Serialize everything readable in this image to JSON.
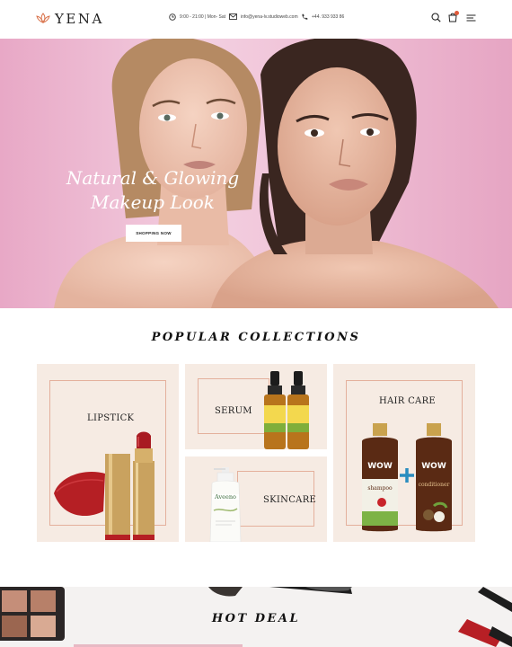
{
  "brand": {
    "name": "YENA",
    "icon": "lotus-icon"
  },
  "header": {
    "hours": "9:00 - 21:00 | Mon- Sat",
    "email": "info@yena-lv.studioweb.com",
    "phone": "+44. 933 933 86",
    "icons": [
      "clock-icon",
      "mail-icon",
      "phone-icon",
      "search-icon",
      "cart-icon",
      "menu-icon"
    ],
    "accent": "#e05a3a"
  },
  "hero": {
    "title_line1": "Natural & Glowing",
    "title_line2": "Makeup Look",
    "button": "SHOPPING NOW",
    "background": "#efbfd6"
  },
  "collections": {
    "title": "POPULAR COLLECTIONS",
    "items": [
      {
        "label": "LIPSTICK"
      },
      {
        "label": "SERUM"
      },
      {
        "label": "SKINCARE"
      },
      {
        "label": "HAIR CARE"
      }
    ],
    "card_color": "#f6ebe3",
    "frame_color": "#e4b09c"
  },
  "hot_deal": {
    "title": "HOT DEAL"
  },
  "product_text": {
    "serum": "VITAMIN C SERUM",
    "lotion": "Aveeno",
    "wow": "WOW",
    "shampoo": "shampoo",
    "conditioner": "conditioner"
  }
}
